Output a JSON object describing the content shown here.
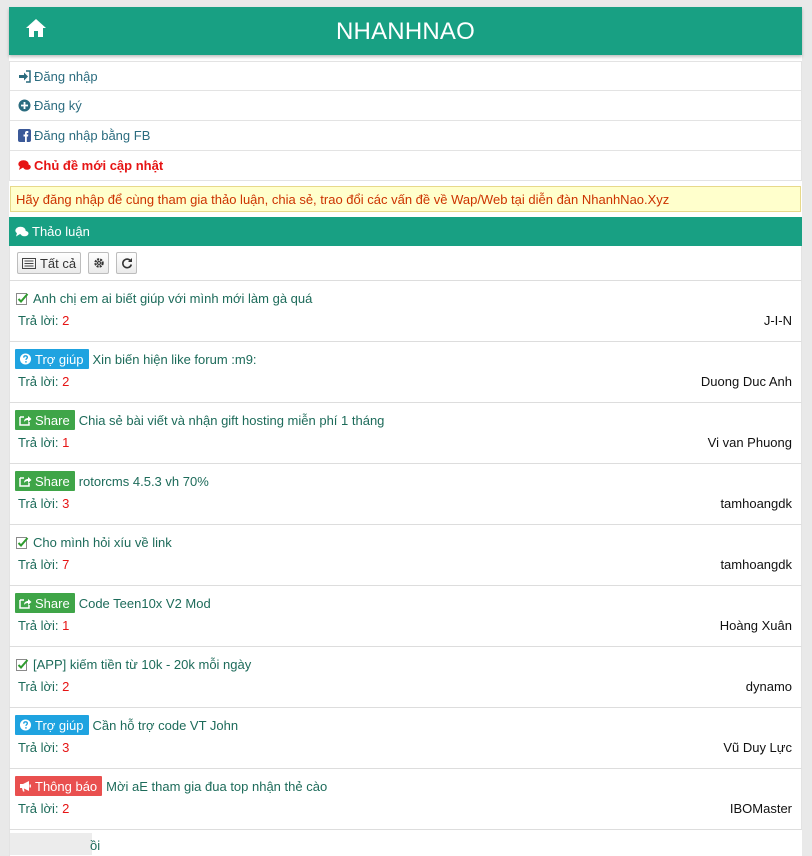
{
  "header": {
    "title": "NHANHNAO"
  },
  "menu": {
    "login": "Đăng nhập",
    "register": "Đăng ký",
    "login_fb": "Đăng nhập bằng FB",
    "latest": "Chủ đề mới cập nhật"
  },
  "notice": "Hãy đăng nhập để cùng tham gia thảo luận, chia sẻ, trao đổi các vấn đề về Wap/Web tại diễn đàn NhanhNao.Xyz",
  "section": {
    "title": "Thảo luận"
  },
  "toolbar": {
    "all_label": "Tất cả"
  },
  "reply_label": "Trả lời:",
  "topics": [
    {
      "badge": "",
      "title": "Anh chị em ai biết giúp với mình mới làm gà quá",
      "replies": "2",
      "author": "J-I-N"
    },
    {
      "badge": "Trợ giúp",
      "title": "Xin biến hiện like forum :m9:",
      "replies": "2",
      "author": "Duong Duc Anh"
    },
    {
      "badge": "Share",
      "title": "Chia sẻ bài viết và nhận gift hosting miễn phí 1 tháng",
      "replies": "1",
      "author": "Vi van Phuong"
    },
    {
      "badge": "Share",
      "title": "rotorcms 4.5.3 vh 70%",
      "replies": "3",
      "author": "tamhoangdk"
    },
    {
      "badge": "",
      "title": "Cho mình hỏi xíu về link",
      "replies": "7",
      "author": "tamhoangdk"
    },
    {
      "badge": "Share",
      "title": "Code Teen10x V2 Mod",
      "replies": "1",
      "author": "Hoàng Xuân"
    },
    {
      "badge": "",
      "title": "[APP] kiếm tiền từ 10k - 20k mỗi ngày",
      "replies": "2",
      "author": "dynamo"
    },
    {
      "badge": "Trợ giúp",
      "title": "Cần hỗ trợ code VT John",
      "replies": "3",
      "author": "Vũ Duy Lực"
    },
    {
      "badge": "Thông báo",
      "title": "Mời aE tham gia đua top nhận thẻ cào",
      "replies": "2",
      "author": "IBOMaster"
    }
  ],
  "partial_topic": {
    "fragment": "ồi"
  },
  "colors": {
    "accent": "#18a083",
    "hot": "#e61414",
    "help": "#1fa3e0",
    "share": "#3fa548",
    "announce": "#e9504f"
  }
}
